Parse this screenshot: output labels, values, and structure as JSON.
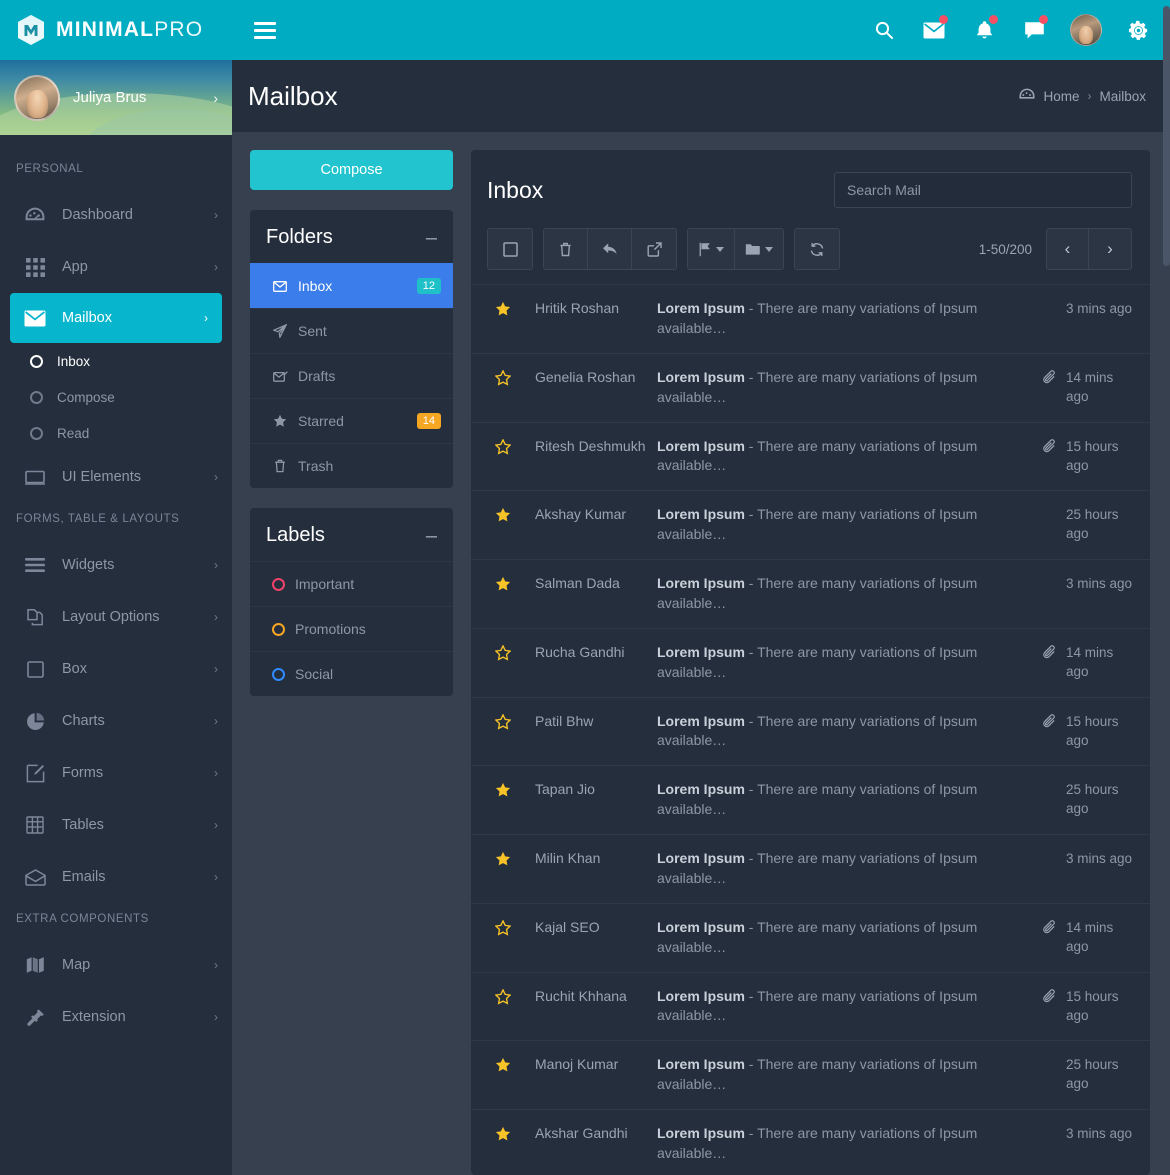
{
  "brand": {
    "name_bold": "MINIMAL",
    "name_light": "PRO",
    "logo_icon": "cube-m-logo-icon"
  },
  "topnav": {
    "menu_toggle": "hamburger-icon",
    "icons": [
      {
        "name": "search-icon",
        "badge": false
      },
      {
        "name": "envelope-icon",
        "badge": true
      },
      {
        "name": "bell-icon",
        "badge": true
      },
      {
        "name": "chat-icon",
        "badge": true
      }
    ],
    "avatar": "user-avatar",
    "settings": "gear-icon"
  },
  "sidebar": {
    "profile": {
      "name": "Juliya Brus",
      "arrow": "›"
    },
    "sections": [
      {
        "heading": "PERSONAL",
        "items": [
          {
            "label": "Dashboard",
            "icon": "dashboard-icon",
            "caret": "›",
            "active": false
          },
          {
            "label": "App",
            "icon": "grid-icon",
            "caret": "›",
            "active": false
          },
          {
            "label": "Mailbox",
            "icon": "envelope-icon",
            "caret": "›",
            "active": true,
            "children": [
              {
                "label": "Inbox",
                "active": true
              },
              {
                "label": "Compose",
                "active": false
              },
              {
                "label": "Read",
                "active": false
              }
            ]
          },
          {
            "label": "UI Elements",
            "icon": "window-icon",
            "caret": "›",
            "active": false
          }
        ]
      },
      {
        "heading": "FORMS, TABLE & LAYOUTS",
        "items": [
          {
            "label": "Widgets",
            "icon": "bars-icon",
            "caret": "›",
            "active": false
          },
          {
            "label": "Layout Options",
            "icon": "copy-icon",
            "caret": "›",
            "active": false
          },
          {
            "label": "Box",
            "icon": "square-icon",
            "caret": "›",
            "active": false
          },
          {
            "label": "Charts",
            "icon": "pie-chart-icon",
            "caret": "›",
            "active": false
          },
          {
            "label": "Forms",
            "icon": "edit-icon",
            "caret": "›",
            "active": false
          },
          {
            "label": "Tables",
            "icon": "table-icon",
            "caret": "›",
            "active": false
          },
          {
            "label": "Emails",
            "icon": "open-envelope-icon",
            "caret": "›",
            "active": false
          }
        ]
      },
      {
        "heading": "EXTRA COMPONENTS",
        "items": [
          {
            "label": "Map",
            "icon": "map-icon",
            "caret": "›",
            "active": false
          },
          {
            "label": "Extension",
            "icon": "plug-icon",
            "caret": "›",
            "active": false
          }
        ]
      }
    ]
  },
  "page": {
    "title": "Mailbox",
    "breadcrumb": {
      "home_icon": "dashboard-icon",
      "home": "Home",
      "separator": "›",
      "current": "Mailbox"
    }
  },
  "mailnav": {
    "compose_label": "Compose",
    "folders": {
      "title": "Folders",
      "minimize": "–",
      "items": [
        {
          "label": "Inbox",
          "icon": "envelope-icon",
          "badge": "12",
          "badge_color": "teal",
          "active": true
        },
        {
          "label": "Sent",
          "icon": "paper-plane-icon",
          "badge": "",
          "badge_color": "",
          "active": false
        },
        {
          "label": "Drafts",
          "icon": "envelope-edit-icon",
          "badge": "",
          "badge_color": "",
          "active": false
        },
        {
          "label": "Starred",
          "icon": "star-icon",
          "badge": "14",
          "badge_color": "orange",
          "active": false
        },
        {
          "label": "Trash",
          "icon": "trash-icon",
          "badge": "",
          "badge_color": "",
          "active": false
        }
      ]
    },
    "labels": {
      "title": "Labels",
      "minimize": "–",
      "items": [
        {
          "label": "Important",
          "color": "#f0426b"
        },
        {
          "label": "Promotions",
          "color": "#f5a623"
        },
        {
          "label": "Social",
          "color": "#2f8bff"
        }
      ]
    }
  },
  "inbox": {
    "title": "Inbox",
    "search_placeholder": "Search Mail",
    "search_value": "",
    "toolbar": [
      {
        "name": "select-all-checkbox",
        "icon": "checkbox-icon",
        "caret": false,
        "group": 0
      },
      {
        "name": "delete-button",
        "icon": "trash-icon",
        "caret": false,
        "group": 1
      },
      {
        "name": "reply-button",
        "icon": "reply-icon",
        "caret": false,
        "group": 1
      },
      {
        "name": "forward-button",
        "icon": "forward-icon",
        "caret": false,
        "group": 1
      },
      {
        "name": "flag-button",
        "icon": "flag-icon",
        "caret": true,
        "group": 2
      },
      {
        "name": "folder-button",
        "icon": "folder-icon",
        "caret": true,
        "group": 2
      },
      {
        "name": "refresh-button",
        "icon": "refresh-icon",
        "caret": false,
        "group": 3
      }
    ],
    "pager": {
      "range": "1-50/200",
      "prev": "‹",
      "next": "›"
    },
    "subject_prefix": "Lorem Ipsum",
    "subject_body": " - There are many variations of Ipsum available…",
    "rows": [
      {
        "from": "Hritik Roshan",
        "starred": true,
        "attachment": false,
        "time": "3 mins ago"
      },
      {
        "from": "Genelia Roshan",
        "starred": false,
        "attachment": true,
        "time": "14 mins ago"
      },
      {
        "from": "Ritesh Deshmukh",
        "starred": false,
        "attachment": true,
        "time": "15 hours ago"
      },
      {
        "from": "Akshay Kumar",
        "starred": true,
        "attachment": false,
        "time": "25 hours ago"
      },
      {
        "from": "Salman Dada",
        "starred": true,
        "attachment": false,
        "time": "3 mins ago"
      },
      {
        "from": "Rucha Gandhi",
        "starred": false,
        "attachment": true,
        "time": "14 mins ago"
      },
      {
        "from": "Patil Bhw",
        "starred": false,
        "attachment": true,
        "time": "15 hours ago"
      },
      {
        "from": "Tapan Jio",
        "starred": true,
        "attachment": false,
        "time": "25 hours ago"
      },
      {
        "from": "Milin Khan",
        "starred": true,
        "attachment": false,
        "time": "3 mins ago"
      },
      {
        "from": "Kajal SEO",
        "starred": false,
        "attachment": true,
        "time": "14 mins ago"
      },
      {
        "from": "Ruchit Khhana",
        "starred": false,
        "attachment": true,
        "time": "15 hours ago"
      },
      {
        "from": "Manoj Kumar",
        "starred": true,
        "attachment": false,
        "time": "25 hours ago"
      },
      {
        "from": "Akshar Gandhi",
        "starred": true,
        "attachment": false,
        "time": "3 mins ago"
      }
    ]
  },
  "colors": {
    "brand_teal": "#00acc1",
    "compose_teal": "#22c4cf",
    "active_nav": "#07b6cd",
    "folder_active_blue": "#3b7dea",
    "badge_teal": "#20c0c9",
    "badge_orange": "#f5a623",
    "star_gold": "#f7c326",
    "panel_bg": "#242e3c",
    "page_bg": "#36404e",
    "header_bg": "#252e3d",
    "notification_red": "#f74f63"
  }
}
